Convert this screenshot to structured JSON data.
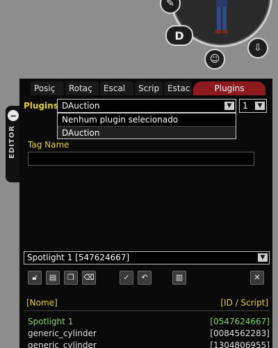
{
  "tabs": [
    {
      "label": "Posiç"
    },
    {
      "label": "Rotaç"
    },
    {
      "label": "Escal"
    },
    {
      "label": "Scrip"
    },
    {
      "label": "Estac"
    },
    {
      "label": "Plugins"
    }
  ],
  "active_tab": "Plugins",
  "side_panel": {
    "label": "EDITOR",
    "dot": "‒"
  },
  "plugins": {
    "label": "Plugins:",
    "selected": "DAuction",
    "count_selected": "1",
    "options": [
      "Nenhum plugin selecionado",
      "DAuction"
    ]
  },
  "tag": {
    "label": "Tag Name",
    "value": ""
  },
  "object_select": {
    "selected": "Spotlight 1 [547624667]"
  },
  "toolbar": {
    "icons": [
      "lock-icon",
      "page-icon",
      "copy-icon",
      "delete-icon",
      "check-icon",
      "undo-icon",
      "document-icon",
      "close-icon"
    ],
    "close_label": "✕"
  },
  "list": {
    "header_name": "[Nome]",
    "header_id": "[ID / Script]",
    "rows": [
      {
        "name": "Spotlight 1",
        "id": "[0547624667]",
        "highlighted": true
      },
      {
        "name": "generic_cylinder",
        "id": "[0084562283]",
        "highlighted": false
      },
      {
        "name": "generic_cylinder",
        "id": "[1304806955]",
        "highlighted": false
      }
    ]
  },
  "colors": {
    "accent": "#e4d21a",
    "active_tab": "#8c1a1f",
    "highlight": "#7fd65a"
  }
}
